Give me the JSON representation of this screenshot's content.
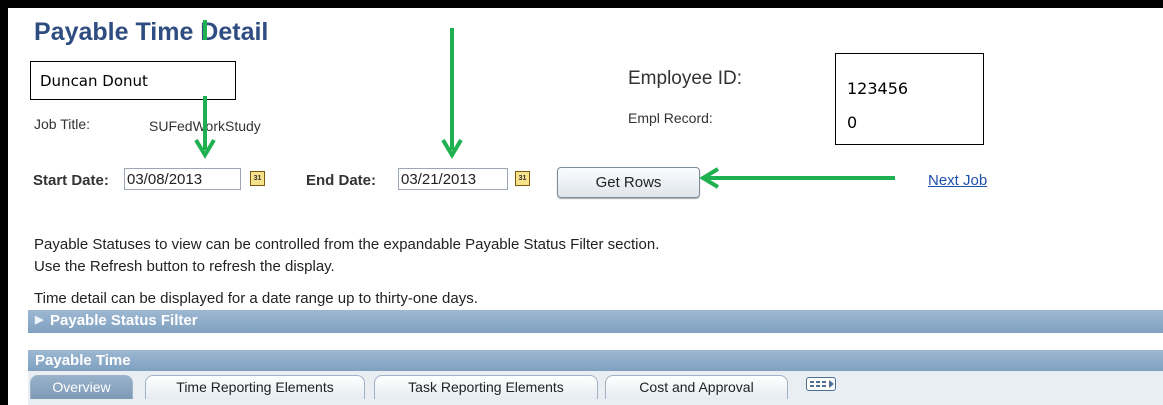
{
  "page_title": "Payable Time Detail",
  "employee_name": "Duncan Donut",
  "job_title_label": "Job Title:",
  "job_title_value": "SUFedWorkStudy",
  "employee_id_label": "Employee ID:",
  "employee_id_value_line1": "123456",
  "empl_record_label": "Empl Record:",
  "empl_record_value": "0",
  "start_date_label": "Start Date:",
  "start_date_value": "03/08/2013",
  "end_date_label": "End Date:",
  "end_date_value": "03/21/2013",
  "calendar_icon_text": "31",
  "get_rows_label": "Get Rows",
  "next_job_label": "Next Job",
  "info_lines": [
    "Payable Statuses to view can be controlled from the expandable Payable Status Filter section.",
    "Use the Refresh button to refresh the display.",
    "Time detail can be displayed for a date range up to thirty-one days."
  ],
  "payable_status_filter_label": "Payable Status Filter",
  "payable_time_label": "Payable Time",
  "tabs": [
    "Overview",
    "Time Reporting Elements",
    "Task Reporting Elements",
    "Cost and Approval"
  ],
  "active_tab": "Overview",
  "colors": {
    "annotation_arrow": "#1fb14f",
    "title": "#2f4d80",
    "section_bar": "#8aa8c6",
    "link": "#1f4fae"
  }
}
